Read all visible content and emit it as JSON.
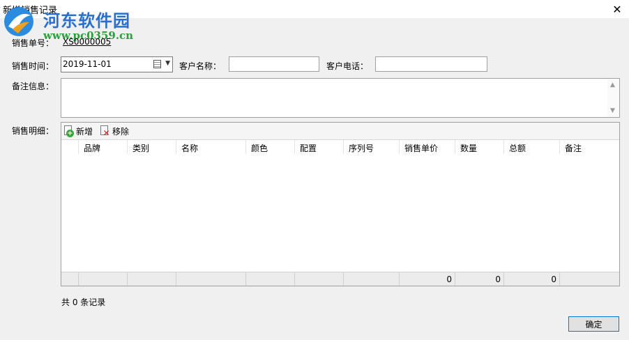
{
  "window": {
    "title": "新增销售记录",
    "close_glyph": "✕"
  },
  "watermark": {
    "logo_icon": "hedong-logo-icon",
    "site_name": "河东软件园",
    "url": "www.pc0359.cn"
  },
  "form": {
    "order_no_label": "销售单号：",
    "order_no_value": "XS0000005",
    "sale_time_label": "销售时间：",
    "sale_time_value": "2019-11-01",
    "customer_name_label": "客户名称：",
    "customer_name_value": "",
    "customer_phone_label": "客户电话：",
    "customer_phone_value": "",
    "remark_label": "备注信息：",
    "remark_value": "",
    "detail_label": "销售明细："
  },
  "toolbar": {
    "add_label": "新增",
    "remove_label": "移除"
  },
  "table": {
    "columns": [
      "",
      "品牌",
      "类别",
      "名称",
      "颜色",
      "配置",
      "序列号",
      "销售单价",
      "数量",
      "总额",
      "备注"
    ],
    "rows": [],
    "footer": [
      "",
      "",
      "",
      "",
      "",
      "",
      "",
      "0",
      "0",
      "0",
      ""
    ]
  },
  "status": {
    "record_count": "共 0 条记录"
  },
  "buttons": {
    "ok_label": "确定"
  },
  "colors": {
    "accent": "#0078d7",
    "watermark_blue": "#2a6fcf",
    "watermark_green": "#2aa03a"
  }
}
